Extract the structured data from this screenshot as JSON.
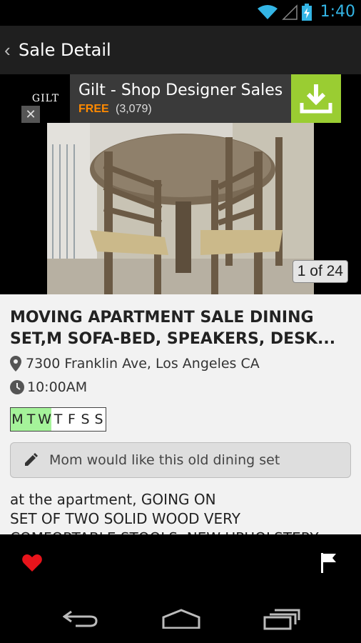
{
  "status_bar": {
    "time": "1:40",
    "icons": [
      "wifi-icon",
      "signal-icon",
      "battery-charging-icon"
    ]
  },
  "action_bar": {
    "title": "Sale Detail",
    "back_icon": "chevron-left-icon"
  },
  "ad": {
    "logo_text": "GILT",
    "title": "Gilt - Shop Designer Sales",
    "price": "FREE",
    "rating_count": "(3,079)",
    "accent_color": "#9acd32",
    "close_icon": "close-icon",
    "action_icon": "download-icon"
  },
  "photo": {
    "counter": "1 of 24"
  },
  "sale": {
    "title": "MOVING APARTMENT SALE DINING SET,M SOFA-BED, SPEAKERS, DESK...",
    "address": "7300 Franklin Ave, Los Angeles CA",
    "time": "10:00AM",
    "days": [
      {
        "letter": "M",
        "active": true
      },
      {
        "letter": "T",
        "active": true
      },
      {
        "letter": "W",
        "active": true
      },
      {
        "letter": "T",
        "active": false
      },
      {
        "letter": "F",
        "active": false
      },
      {
        "letter": "S",
        "active": false
      },
      {
        "letter": "S",
        "active": false
      }
    ],
    "note": "Mom would like this old dining set",
    "description_lines": [
      "at the apartment, GOING ON",
      "SET OF TWO SOLID WOOD VERY",
      "COMFORTABLE STOOLS, NEW UPHOLSTERY"
    ]
  },
  "bottom_actions": {
    "favorite_icon": "heart-icon",
    "favorite_color": "#e8141b",
    "flag_icon": "flag-icon"
  },
  "nav_bar": {
    "icons": [
      "back-nav-icon",
      "home-nav-icon",
      "recents-nav-icon"
    ]
  }
}
